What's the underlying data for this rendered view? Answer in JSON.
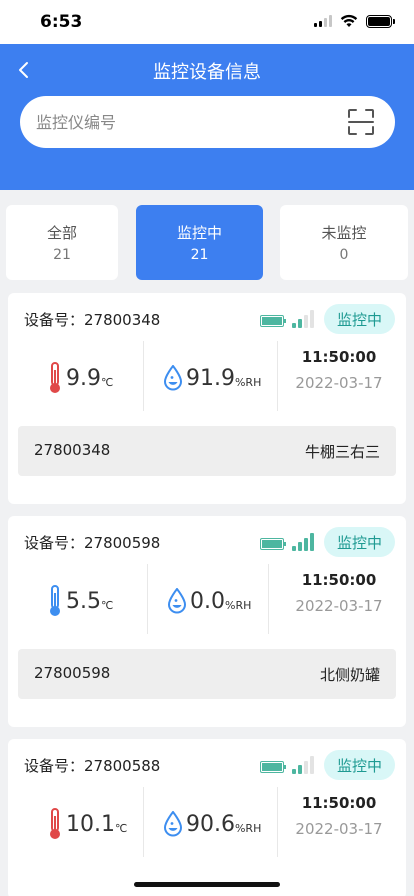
{
  "status_bar": {
    "time": "6:53"
  },
  "header": {
    "title": "监控设备信息",
    "search_placeholder": "监控仪编号"
  },
  "tabs": [
    {
      "label": "全部",
      "count": "21",
      "active": false
    },
    {
      "label": "监控中",
      "count": "21",
      "active": true
    },
    {
      "label": "未监控",
      "count": "0",
      "active": false
    }
  ],
  "devices": [
    {
      "id_label": "设备号：27800348",
      "battery": "full",
      "signal_level": 2,
      "status": "监控中",
      "temperature": "9.9",
      "temp_unit": "℃",
      "temp_color": "#e04848",
      "humidity": "91.9",
      "humidity_unit": "%RH",
      "time": "11:50:00",
      "date": "2022-03-17",
      "device_no": "27800348",
      "location": "牛棚三右三"
    },
    {
      "id_label": "设备号：27800598",
      "battery": "full",
      "signal_level": 4,
      "status": "监控中",
      "temperature": "5.5",
      "temp_unit": "℃",
      "temp_color": "#3d8ef0",
      "humidity": "0.0",
      "humidity_unit": "%RH",
      "time": "11:50:00",
      "date": "2022-03-17",
      "device_no": "27800598",
      "location": "北侧奶罐"
    },
    {
      "id_label": "设备号：27800588",
      "battery": "full",
      "signal_level": 2,
      "status": "监控中",
      "temperature": "10.1",
      "temp_unit": "℃",
      "temp_color": "#e04848",
      "humidity": "90.6",
      "humidity_unit": "%RH",
      "time": "11:50:00",
      "date": "2022-03-17",
      "device_no": "",
      "location": ""
    }
  ],
  "colors": {
    "accent": "#3d7ff0",
    "badge_bg": "#d9f7f7",
    "badge_text": "#1e9a92",
    "device_icon": "#4db6a0"
  }
}
